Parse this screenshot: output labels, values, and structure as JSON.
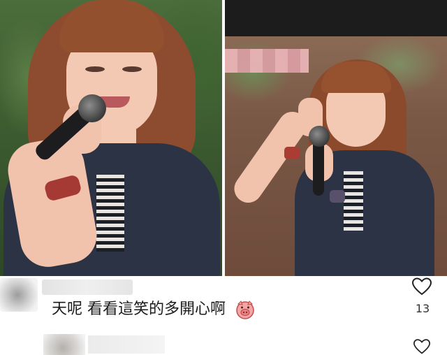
{
  "comments": [
    {
      "text": "天呢 看看這笑的多開心啊",
      "emoji_icon": "pig-face-emoji-icon",
      "like_count": "13"
    },
    {
      "text": "",
      "like_count": ""
    }
  ],
  "colors": {
    "text": "#1b1b1b",
    "heart_outline": "#222222",
    "background": "#ffffff"
  }
}
